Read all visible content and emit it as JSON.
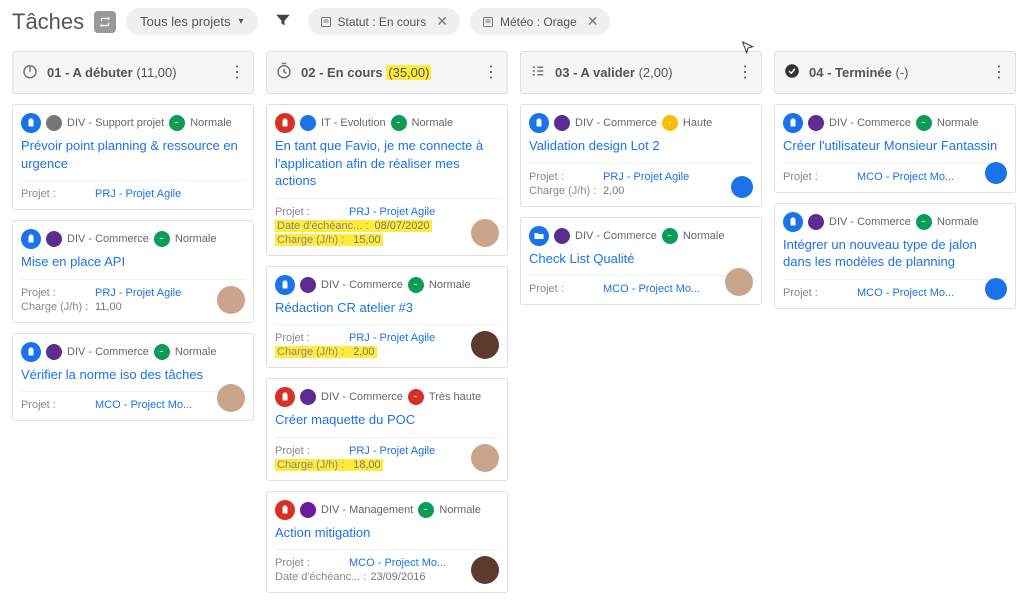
{
  "header": {
    "title": "Tâches",
    "project_selector": "Tous les projets",
    "filters": [
      {
        "label": "Statut : En cours"
      },
      {
        "label": "Météo : Orage"
      }
    ]
  },
  "columns": [
    {
      "icon": "power",
      "title": "01 - A débuter",
      "count": "(11,00)",
      "highlight_count": false,
      "cards": [
        {
          "type_color": "#1a73e8",
          "type_icon": "clipboard",
          "cat_icon_bg": "#777",
          "category": "DIV - Support projet",
          "priority": "Normale",
          "priority_color": "#0b9d58",
          "title": "Prévoir point planning & ressource en urgence",
          "rows": [
            {
              "label": "Projet :",
              "value": "PRJ - Projet Agile",
              "link": true
            }
          ],
          "avatar": null
        },
        {
          "type_color": "#1a73e8",
          "type_icon": "clipboard",
          "cat_icon_bg": "#5c2d91",
          "category": "DIV - Commerce",
          "priority": "Normale",
          "priority_color": "#0b9d58",
          "title": "Mise en place API",
          "rows": [
            {
              "label": "Projet :",
              "value": "PRJ - Projet Agile",
              "link": true
            },
            {
              "label": "Charge (J/h) :",
              "value": "11,00"
            }
          ],
          "avatar": "#c9a58b"
        },
        {
          "type_color": "#1a73e8",
          "type_icon": "clipboard",
          "cat_icon_bg": "#5c2d91",
          "category": "DIV - Commerce",
          "priority": "Normale",
          "priority_color": "#0b9d58",
          "title": "Vérifier la norme iso des tâches",
          "rows": [
            {
              "label": "Projet :",
              "value": "MCO - Project Mo...",
              "link": true
            }
          ],
          "avatar": "#c9a58b"
        }
      ]
    },
    {
      "icon": "timer",
      "title": "02 - En cours",
      "count": "(35,00)",
      "highlight_count": true,
      "cards": [
        {
          "type_color": "#d93025",
          "type_icon": "clipboard",
          "cat_icon_bg": "#1a73e8",
          "category": "IT - Evolution",
          "priority": "Normale",
          "priority_color": "#0b9d58",
          "title": "En tant que Favio, je me connecte à l'application afin de réaliser mes actions",
          "rows": [
            {
              "label": "Projet :",
              "value": "PRJ - Projet Agile",
              "link": true
            },
            {
              "label": "Date d'échéanc... :",
              "value": "08/07/2020",
              "hl": true
            },
            {
              "label": "Charge (J/h) :",
              "value": "15,00",
              "hl": true
            }
          ],
          "avatar": "#c9a58b"
        },
        {
          "type_color": "#1a73e8",
          "type_icon": "clipboard",
          "cat_icon_bg": "#5c2d91",
          "category": "DIV - Commerce",
          "priority": "Normale",
          "priority_color": "#0b9d58",
          "title": "Rédaction CR atelier #3",
          "rows": [
            {
              "label": "Projet :",
              "value": "PRJ - Projet Agile",
              "link": true
            },
            {
              "label": "Charge (J/h) :",
              "value": "2,00",
              "hl": true
            }
          ],
          "avatar": "#5c3a2e"
        },
        {
          "type_color": "#d93025",
          "type_icon": "clipboard",
          "cat_icon_bg": "#5c2d91",
          "category": "DIV - Commerce",
          "priority": "Très haute",
          "priority_color": "#d93025",
          "title": "Créer maquette du POC",
          "rows": [
            {
              "label": "Projet :",
              "value": "PRJ - Projet Agile",
              "link": true
            },
            {
              "label": "Charge (J/h) :",
              "value": "18,00",
              "hl": true
            }
          ],
          "avatar": "#c9a58b"
        },
        {
          "type_color": "#d93025",
          "type_icon": "clipboard",
          "cat_icon_bg": "#6a1b9a",
          "category": "DIV - Management",
          "priority": "Normale",
          "priority_color": "#0b9d58",
          "title": "Action mitigation",
          "rows": [
            {
              "label": "Projet :",
              "value": "MCO - Project Mo...",
              "link": true
            },
            {
              "label": "Date d'échéanc... :",
              "value": "23/09/2016"
            }
          ],
          "avatar": "#5c3a2e"
        }
      ]
    },
    {
      "icon": "checklist",
      "title": "03 - A valider",
      "count": "(2,00)",
      "highlight_count": false,
      "cards": [
        {
          "type_color": "#1a73e8",
          "type_icon": "clipboard",
          "cat_icon_bg": "#5c2d91",
          "category": "DIV - Commerce",
          "priority": "Haute",
          "priority_color": "#fbbc04",
          "title": "Validation design Lot 2",
          "rows": [
            {
              "label": "Projet :",
              "value": "PRJ - Projet Agile",
              "link": true
            },
            {
              "label": "Charge (J/h) :",
              "value": "2,00"
            }
          ],
          "avatar": "#1a73e8",
          "avatar_dot": true
        },
        {
          "type_color": "#1a73e8",
          "type_icon": "folder",
          "cat_icon_bg": "#5c2d91",
          "category": "DIV - Commerce",
          "priority": "Normale",
          "priority_color": "#0b9d58",
          "title": "Check List Qualité",
          "rows": [
            {
              "label": "Projet :",
              "value": "MCO - Project Mo...",
              "link": true
            }
          ],
          "avatar": "#c9a58b"
        }
      ]
    },
    {
      "icon": "done",
      "title": "04 - Terminée",
      "count": "(-)",
      "highlight_count": false,
      "cards": [
        {
          "type_color": "#1a73e8",
          "type_icon": "clipboard",
          "cat_icon_bg": "#5c2d91",
          "category": "DIV - Commerce",
          "priority": "Normale",
          "priority_color": "#0b9d58",
          "title": "Créer l'utilisateur Monsieur Fantassin",
          "rows": [
            {
              "label": "Projet :",
              "value": "MCO - Project Mo...",
              "link": true
            }
          ],
          "avatar": "#1a73e8",
          "avatar_dot": true
        },
        {
          "type_color": "#1a73e8",
          "type_icon": "clipboard",
          "cat_icon_bg": "#5c2d91",
          "category": "DIV - Commerce",
          "priority": "Normale",
          "priority_color": "#0b9d58",
          "title": "Intégrer un nouveau type de jalon dans les modèles de planning",
          "rows": [
            {
              "label": "Projet :",
              "value": "MCO - Project Mo...",
              "link": true
            }
          ],
          "avatar": "#1a73e8",
          "avatar_dot": true
        }
      ]
    }
  ]
}
